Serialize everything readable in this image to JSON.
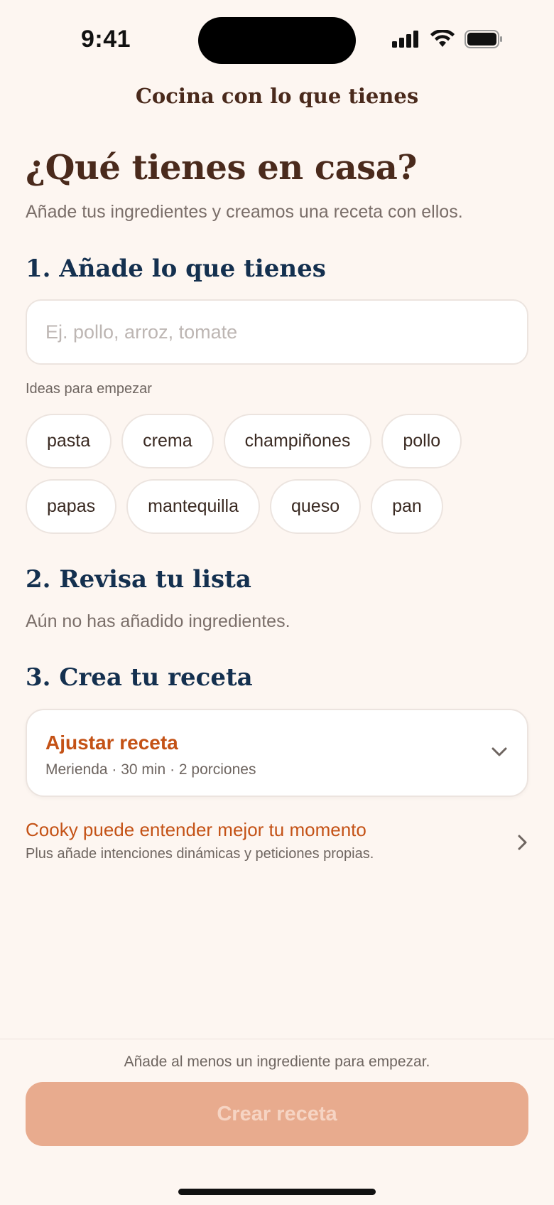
{
  "status_bar": {
    "time": "9:41"
  },
  "header": {
    "title": "Cocina con lo que tienes"
  },
  "intro": {
    "headline": "¿Qué tienes en casa?",
    "subtitle": "Añade tus ingredientes y creamos una receta con ellos."
  },
  "step1": {
    "title": "1. Añade lo que tienes",
    "input_placeholder": "Ej. pollo, arroz, tomate",
    "input_value": "",
    "ideas_label": "Ideas para empezar",
    "chips_row1": [
      "pasta",
      "crema",
      "champiñones",
      "pollo"
    ],
    "chips_row2": [
      "papas",
      "mantequilla",
      "queso",
      "pan"
    ]
  },
  "step2": {
    "title": "2. Revisa tu lista",
    "empty_text": "Aún no has añadido ingredientes."
  },
  "step3": {
    "title": "3. Crea tu receta",
    "card_title": "Ajustar receta",
    "card_meta": "Merienda · 30 min · 2 porciones"
  },
  "promo": {
    "title": "Cooky puede entender mejor tu momento",
    "subtitle": "Plus añade intenciones dinámicas y peticiones propias."
  },
  "footer": {
    "hint": "Añade al menos un ingrediente para empezar.",
    "button_label": "Crear receta"
  },
  "colors": {
    "background": "#fdf6f1",
    "heading_brown": "#4a2a1c",
    "section_navy": "#14304f",
    "accent_orange": "#c45216",
    "button_disabled": "#e8ab8e"
  },
  "icons": {
    "signal": "cellular-signal-icon",
    "wifi": "wifi-icon",
    "battery": "battery-icon",
    "expand": "chevron-down-icon",
    "promo_arrow": "chevron-right-icon"
  }
}
